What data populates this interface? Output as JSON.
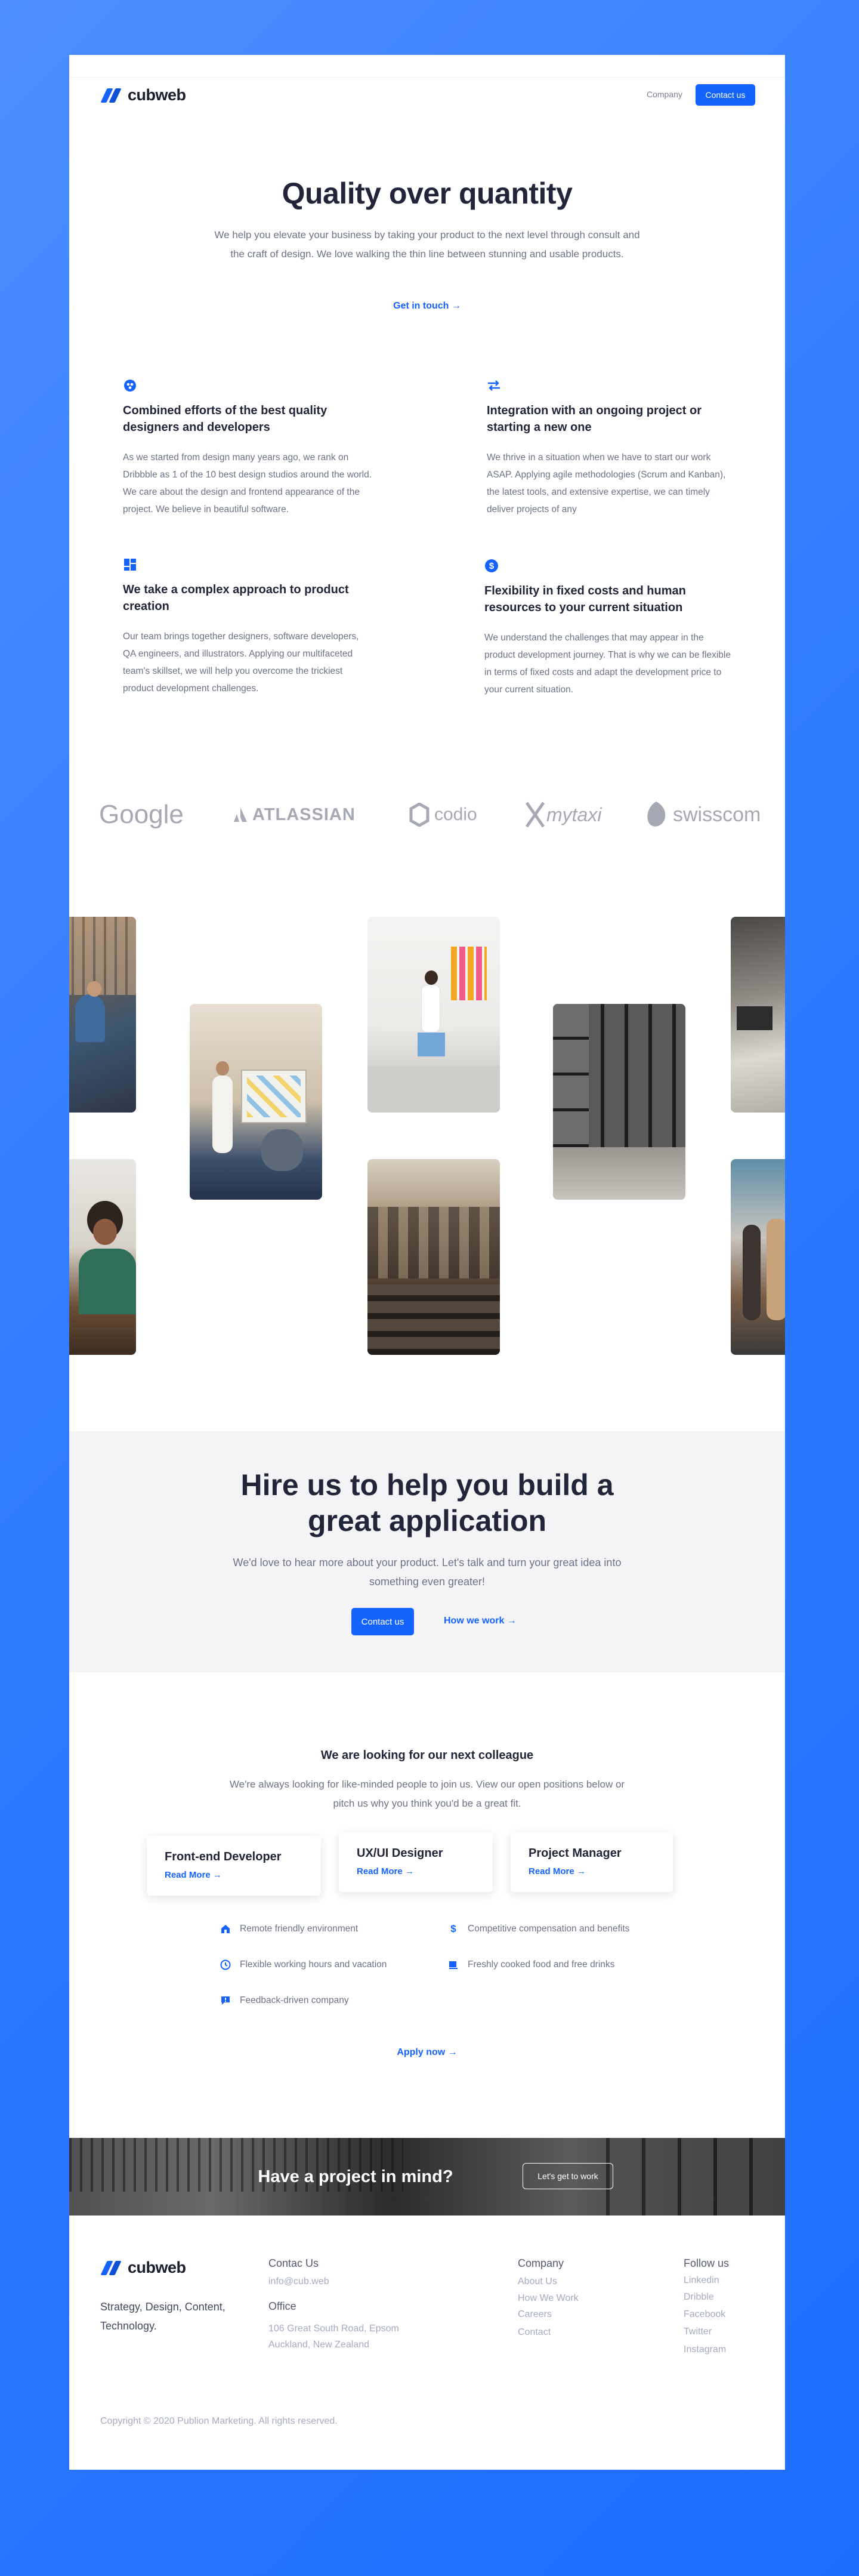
{
  "header": {
    "brand": "cubweb",
    "nav_company": "Company",
    "nav_contact": "Contact us"
  },
  "hero": {
    "title": "Quality over quantity",
    "subtitle": "We help you elevate your business by taking your product to the next level through consult and the craft of design. We love walking the thin line between stunning and usable products.",
    "cta": "Get in touch →"
  },
  "features": [
    {
      "icon": "team-icon",
      "title": "Combined efforts of the best quality designers and developers",
      "text": "As we started from design many years ago, we rank on Dribbble as 1 of the 10 best design studios around the world. We care about the design and frontend appearance of the project. We believe in beautiful software."
    },
    {
      "icon": "swap-arrows-icon",
      "title": "Integration with an ongoing project or starting a new one",
      "text": "We thrive in a situation when we have to start our work ASAP. Applying agile methodologies (Scrum and Kanban), the latest tools, and extensive expertise, we can timely deliver projects of any"
    },
    {
      "icon": "dashboard-icon",
      "title": "We take a complex approach to product creation",
      "text": "Our team brings together designers, software developers, QA engineers, and illustrators. Applying our multifaceted team's skillset, we will help you overcome the trickiest product development challenges."
    },
    {
      "icon": "dollar-icon",
      "title": "Flexibility in fixed costs and human resources to your current situation",
      "text": "We understand the challenges that may appear in the product development journey. That is why we can be flexible in terms of fixed costs and adapt the development price to your current situation."
    }
  ],
  "clients": [
    "Google",
    "ATLASSIAN",
    "codio",
    "mytaxi",
    "swisscom"
  ],
  "hire": {
    "title_line1": "Hire us to help you build a",
    "title_line2": "great application",
    "subtitle": "We'd love to hear more about your product. Let's talk and turn your great idea into something even greater!",
    "contact_btn": "Contact us",
    "how_link": "How we work →"
  },
  "jobs": {
    "title": "We are looking for our next colleague",
    "subtitle": "We're always looking for like-minded people to join us. View our open positions below or pitch us why you think you'd be a great fit.",
    "openings": [
      {
        "title": "Front-end Developer",
        "link": "Read More →"
      },
      {
        "title": "UX/UI Designer",
        "link": "Read More →"
      },
      {
        "title": "Project Manager",
        "link": "Read More →"
      }
    ],
    "perks": [
      {
        "icon": "home-icon",
        "text": "Remote friendly environment"
      },
      {
        "icon": "dollar-sign-icon",
        "text": "Competitive compensation and benefits"
      },
      {
        "icon": "clock-icon",
        "text": "Flexible working hours and vacation"
      },
      {
        "icon": "coffee-icon",
        "text": "Freshly cooked food and free drinks"
      },
      {
        "icon": "chat-icon",
        "text": "Feedback-driven company"
      }
    ],
    "apply": "Apply now →"
  },
  "cta": {
    "title": "Have a project in mind?",
    "button": "Let's get to work"
  },
  "footer": {
    "brand": "cubweb",
    "tagline": "Strategy, Design, Content, Technology.",
    "contact_head": "Contac Us",
    "email": "info@cub.web",
    "office_head": "Office",
    "address": "106 Great South Road, Epsom Auckland, New Zealand",
    "company_head": "Company",
    "company_links": [
      "About Us",
      "How We Work",
      "Careers",
      "Contact"
    ],
    "follow_head": "Follow us",
    "social_links": [
      "Linkedin",
      "Dribble",
      "Facebook",
      "Twitter",
      "Instagram"
    ],
    "copyright": "Copyright © 2020 Publion Marketing. All rights reserved."
  },
  "colors": {
    "accent": "#1563ff",
    "heading": "#22253a",
    "body_text": "#6d7286",
    "band_bg": "#f4f4f6",
    "page_bg_gradient": "#3f86ff"
  }
}
